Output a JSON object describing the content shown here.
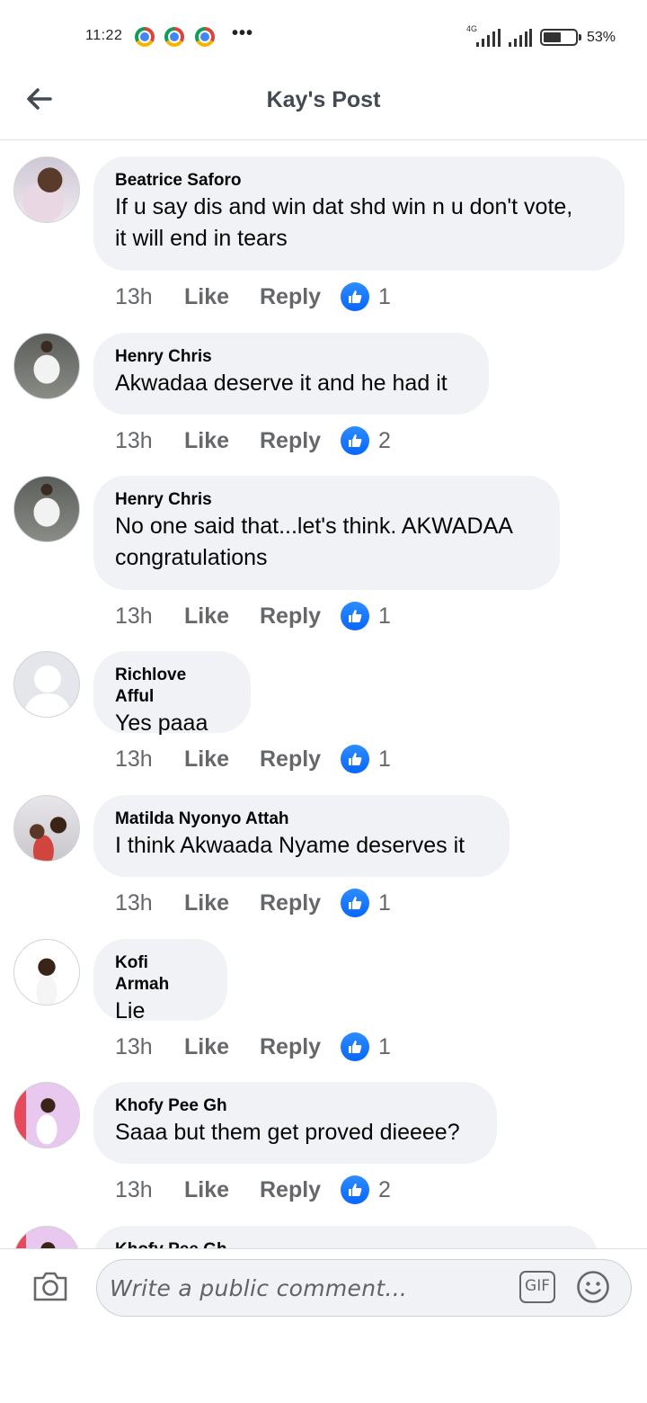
{
  "status_bar": {
    "time": "11:22",
    "network": "4G",
    "battery": "53%"
  },
  "header": {
    "title": "Kay's Post"
  },
  "comments": [
    {
      "author": "Beatrice Saforo",
      "lines": [
        "If u say dis and win dat shd win n u don't vote,",
        "it will end in tears"
      ],
      "time": "13h",
      "like": "Like",
      "reply": "Reply",
      "reactions": "1"
    },
    {
      "author": "Henry Chris",
      "lines": [
        "Akwadaa deserve it and he had it"
      ],
      "time": "13h",
      "like": "Like",
      "reply": "Reply",
      "reactions": "2"
    },
    {
      "author": "Henry Chris",
      "lines": [
        "No one said that...let's think. AKWADAA",
        "congratulations"
      ],
      "time": "13h",
      "like": "Like",
      "reply": "Reply",
      "reactions": "1"
    },
    {
      "author": "Richlove Afful",
      "lines": [
        "Yes paaa"
      ],
      "time": "13h",
      "like": "Like",
      "reply": "Reply",
      "reactions": "1"
    },
    {
      "author": "Matilda Nyonyo Attah",
      "lines": [
        "I think Akwaada Nyame deserves it"
      ],
      "time": "13h",
      "like": "Like",
      "reply": "Reply",
      "reactions": "1"
    },
    {
      "author": "Kofi Armah",
      "lines": [
        "Lie"
      ],
      "time": "13h",
      "like": "Like",
      "reply": "Reply",
      "reactions": "1"
    },
    {
      "author": "Khofy Pee Gh",
      "lines": [
        "Saaa but them get proved dieeee?"
      ],
      "time": "13h",
      "like": "Like",
      "reply": "Reply",
      "reactions": "2"
    },
    {
      "author": "Khofy Pee Gh"
    }
  ],
  "composer": {
    "placeholder": "Write a public comment...",
    "gif_label": "GIF"
  },
  "colors": {
    "like_blue": "#0866ff",
    "bubble_bg": "#f0f2f5",
    "meta_gray": "#65676b"
  }
}
